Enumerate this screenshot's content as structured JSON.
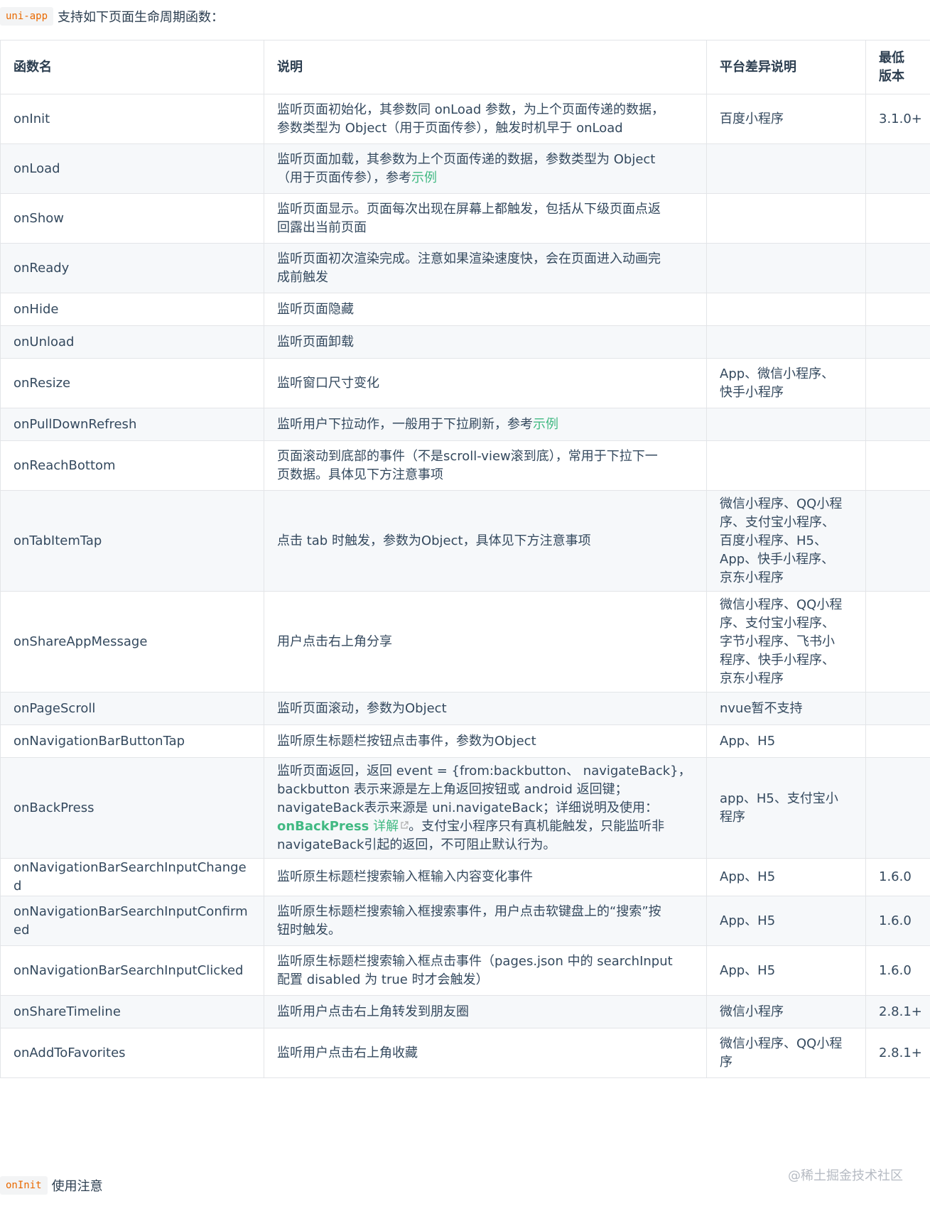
{
  "intro": {
    "code": "uni-app",
    "text": "支持如下页面生命周期函数："
  },
  "table": {
    "headers": {
      "name": "函数名",
      "desc": "说明",
      "platform": "平台差异说明",
      "version_line1": "最低",
      "version_line2": "版本"
    },
    "rows": [
      {
        "name": "onInit",
        "desc_line1": "监听页面初始化，其参数同 onLoad 参数，为上个页面传递的数据，",
        "desc_line2": "参数类型为 Object（用于页面传参），触发时机早于 onLoad",
        "platform": "百度小程序",
        "version": "3.1.0+"
      },
      {
        "name": "onLoad",
        "desc_line1": "监听页面加载，其参数为上个页面传递的数据，参数类型为 Object",
        "desc_line2_pre": "（用于页面传参），参考",
        "desc_link": "示例",
        "platform": "",
        "version": ""
      },
      {
        "name": "onShow",
        "desc_line1": "监听页面显示。页面每次出现在屏幕上都触发，包括从下级页面点返",
        "desc_line2": "回露出当前页面",
        "platform": "",
        "version": ""
      },
      {
        "name": "onReady",
        "desc_line1": "监听页面初次渲染完成。注意如果渲染速度快，会在页面进入动画完",
        "desc_line2": "成前触发",
        "platform": "",
        "version": ""
      },
      {
        "name": "onHide",
        "desc": "监听页面隐藏",
        "platform": "",
        "version": ""
      },
      {
        "name": "onUnload",
        "desc": "监听页面卸载",
        "platform": "",
        "version": ""
      },
      {
        "name": "onResize",
        "desc": "监听窗口尺寸变化",
        "platform_line1": "App、微信小程序、",
        "platform_line2": "快手小程序",
        "version": ""
      },
      {
        "name": "onPullDownRefresh",
        "desc_pre": "监听用户下拉动作，一般用于下拉刷新，参考",
        "desc_link": "示例",
        "platform": "",
        "version": ""
      },
      {
        "name": "onReachBottom",
        "desc_line1": "页面滚动到底部的事件（不是scroll-view滚到底），常用于下拉下一",
        "desc_line2": "页数据。具体见下方注意事项",
        "platform": "",
        "version": ""
      },
      {
        "name": "onTabItemTap",
        "desc": "点击 tab 时触发，参数为Object，具体见下方注意事项",
        "platform_lines": [
          "微信小程序、QQ小程",
          "序、支付宝小程序、",
          "百度小程序、H5、",
          "App、快手小程序、",
          "京东小程序"
        ],
        "version": ""
      },
      {
        "name": "onShareAppMessage",
        "desc": "用户点击右上角分享",
        "platform_lines": [
          "微信小程序、QQ小程",
          "序、支付宝小程序、",
          "字节小程序、飞书小",
          "程序、快手小程序、",
          "京东小程序"
        ],
        "version": ""
      },
      {
        "name": "onPageScroll",
        "desc": "监听页面滚动，参数为Object",
        "platform": "nvue暂不支持",
        "version": ""
      },
      {
        "name": "onNavigationBarButtonTap",
        "desc": "监听原生标题栏按钮点击事件，参数为Object",
        "platform": "App、H5",
        "version": ""
      },
      {
        "name": "onBackPress",
        "desc_line1": "监听页面返回，返回 event = {from:backbutton、 navigateBack}，",
        "desc_line2": "backbutton 表示来源是左上角返回按钮或 android 返回键；",
        "desc_line3": "navigateBack表示来源是 uni.navigateBack；详细说明及使用：",
        "desc_link_code": "onBackPress",
        "desc_link_text": " 详解",
        "desc_line4_post": "。支付宝小程序只有真机能触发，只能监听非",
        "desc_line5": "navigateBack引起的返回，不可阻止默认行为。",
        "platform_line1": "app、H5、支付宝小",
        "platform_line2": "程序",
        "version": ""
      },
      {
        "name": "onNavigationBarSearchInputChanged",
        "desc": "监听原生标题栏搜索输入框输入内容变化事件",
        "platform": "App、H5",
        "version": "1.6.0"
      },
      {
        "name": "onNavigationBarSearchInputConfirmed",
        "desc_line1": "监听原生标题栏搜索输入框搜索事件，用户点击软键盘上的“搜索”按",
        "desc_line2": "钮时触发。",
        "platform": "App、H5",
        "version": "1.6.0"
      },
      {
        "name": "onNavigationBarSearchInputClicked",
        "desc_line1": "监听原生标题栏搜索输入框点击事件（pages.json 中的 searchInput",
        "desc_line2": "配置 disabled 为 true 时才会触发）",
        "platform": "App、H5",
        "version": "1.6.0"
      },
      {
        "name": "onShareTimeline",
        "desc": "监听用户点击右上角转发到朋友圈",
        "platform": "微信小程序",
        "version": "2.8.1+"
      },
      {
        "name": "onAddToFavorites",
        "desc": "监听用户点击右上角收藏",
        "platform_line1": "微信小程序、QQ小程",
        "platform_line2": "序",
        "version": "2.8.1+"
      }
    ]
  },
  "footer": {
    "code": "onInit",
    "text": "使用注意"
  },
  "watermark": "@稀土掘金技术社区",
  "colors": {
    "link": "#42b983",
    "code": "#e96900",
    "border": "#e3e5e8",
    "stripe": "#f6f8fa"
  },
  "icons": [
    "external-link-icon"
  ]
}
